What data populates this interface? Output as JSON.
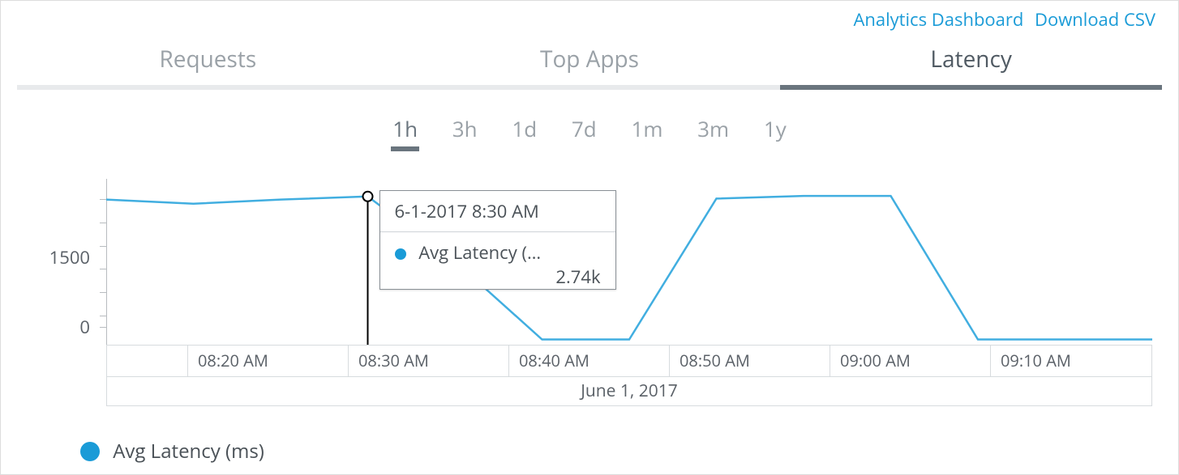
{
  "links": {
    "analytics": "Analytics Dashboard",
    "download_csv": "Download CSV"
  },
  "tabs": [
    {
      "label": "Requests",
      "active": false
    },
    {
      "label": "Top Apps",
      "active": false
    },
    {
      "label": "Latency",
      "active": true
    }
  ],
  "ranges": [
    "1h",
    "3h",
    "1d",
    "7d",
    "1m",
    "3m",
    "1y"
  ],
  "active_range": "1h",
  "legend": {
    "series": "Avg Latency (ms)"
  },
  "tooltip": {
    "timestamp": "6-1-2017 8:30 AM",
    "series_label": "Avg Latency (…",
    "value": "2.74k",
    "at_x": "08:30 AM"
  },
  "chart_data": {
    "type": "line",
    "title": "",
    "xlabel": "",
    "ylabel": "",
    "date_label": "June 1, 2017",
    "y_ticks": [
      0,
      1500
    ],
    "ylim": [
      -100,
      3000
    ],
    "x_tick_labels": [
      "08:20 AM",
      "08:30 AM",
      "08:40 AM",
      "08:50 AM",
      "09:00 AM",
      "09:10 AM"
    ],
    "categories": [
      "08:15 AM",
      "08:20 AM",
      "08:25 AM",
      "08:30 AM",
      "08:35 AM",
      "08:40 AM",
      "08:45 AM",
      "08:50 AM",
      "08:55 AM",
      "09:00 AM",
      "09:05 AM",
      "09:10 AM",
      "09:15 AM"
    ],
    "series": [
      {
        "name": "Avg Latency (ms)",
        "color": "#41aee0",
        "values": [
          2680,
          2600,
          2680,
          2740,
          1500,
          0,
          0,
          2700,
          2750,
          2750,
          0,
          0,
          0
        ]
      }
    ],
    "hover_index": 3
  }
}
